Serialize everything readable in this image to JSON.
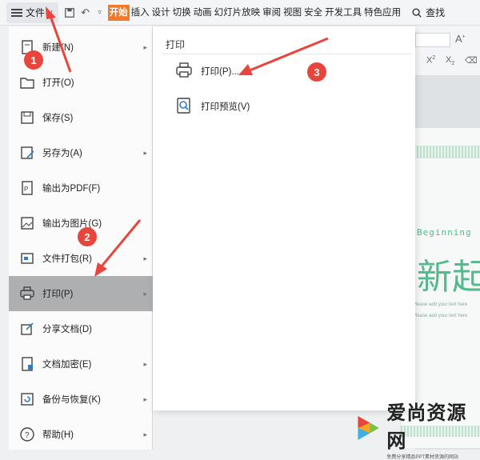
{
  "ribbon": {
    "file_label": "文件",
    "tabs": [
      {
        "label": "开始",
        "active": true
      },
      {
        "label": "插入",
        "active": false
      },
      {
        "label": "设计",
        "active": false
      },
      {
        "label": "切换",
        "active": false
      },
      {
        "label": "动画",
        "active": false
      },
      {
        "label": "幻灯片放映",
        "active": false
      },
      {
        "label": "审阅",
        "active": false
      },
      {
        "label": "视图",
        "active": false
      },
      {
        "label": "安全",
        "active": false
      },
      {
        "label": "开发工具",
        "active": false
      },
      {
        "label": "特色应用",
        "active": false
      }
    ],
    "search_label": "查找",
    "accent": "#f07a2b"
  },
  "file_menu": {
    "items": [
      {
        "label": "新建(N)",
        "icon": "new-file-icon",
        "has_submenu": true
      },
      {
        "label": "打开(O)",
        "icon": "folder-open-icon",
        "has_submenu": false
      },
      {
        "label": "保存(S)",
        "icon": "save-icon",
        "has_submenu": false
      },
      {
        "label": "另存为(A)",
        "icon": "save-as-icon",
        "has_submenu": true
      },
      {
        "label": "输出为PDF(F)",
        "icon": "pdf-icon",
        "has_submenu": false
      },
      {
        "label": "输出为图片(G)",
        "icon": "image-export-icon",
        "has_submenu": false
      },
      {
        "label": "文件打包(R)",
        "icon": "package-icon",
        "has_submenu": true
      },
      {
        "label": "打印(P)",
        "icon": "printer-icon",
        "has_submenu": true,
        "selected": true
      },
      {
        "label": "分享文档(D)",
        "icon": "share-icon",
        "has_submenu": false
      },
      {
        "label": "文档加密(E)",
        "icon": "lock-document-icon",
        "has_submenu": true
      },
      {
        "label": "备份与恢复(K)",
        "icon": "backup-icon",
        "has_submenu": true
      },
      {
        "label": "帮助(H)",
        "icon": "help-icon",
        "has_submenu": true
      }
    ]
  },
  "print_submenu": {
    "header": "打印",
    "items": [
      {
        "label": "打印(P)...",
        "icon": "printer-icon"
      },
      {
        "label": "打印预览(V)",
        "icon": "print-preview-icon"
      }
    ]
  },
  "annotations": {
    "badges": [
      "1",
      "2",
      "3"
    ],
    "color": "#e8453c"
  },
  "slide_preview": {
    "heading": "新起",
    "subtitle": "Beginning",
    "body_lines": [
      "Please add your text here",
      "Please add your text here"
    ]
  },
  "watermark": {
    "title": "爱尚资源网",
    "tagline": "免费分享精品PPT素材资源的网站"
  }
}
